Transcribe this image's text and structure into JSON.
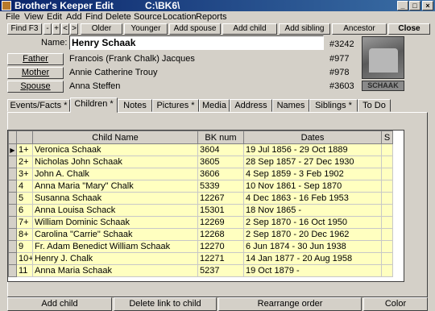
{
  "window": {
    "title": "Brother's Keeper Edit",
    "path": "C:\\BK6\\",
    "min": "_",
    "max": "□",
    "close": "×"
  },
  "menu": [
    "File",
    "View",
    "Edit",
    "Add",
    "Find",
    "Delete",
    "Source",
    "Location",
    "Reports"
  ],
  "toolbar": {
    "find": "Find  F3",
    "minus": "-",
    "plus": "+",
    "prev": "<",
    "next": ">",
    "older": "Older",
    "younger": "Younger",
    "add_spouse": "Add spouse",
    "add_child": "Add child",
    "add_sibling": "Add sibling",
    "ancestor": "Ancestor",
    "close": "Close"
  },
  "person": {
    "name_label": "Name:",
    "name": "Henry Schaak",
    "id": "#3242",
    "father_label": "Father",
    "father": "Francois (Frank Chalk) Jacques",
    "father_id": "#977",
    "mother_label": "Mother",
    "mother": "Annie Catherine Trouy",
    "mother_id": "#978",
    "spouse_label": "Spouse",
    "spouse": "Anna Steffen",
    "spouse_id": "#3603",
    "photo_caption": "SCHAAK"
  },
  "tabs": [
    "Events/Facts *",
    "Children *",
    "Notes",
    "Pictures *",
    "Media",
    "Address",
    "Names",
    "Siblings *",
    "To Do"
  ],
  "table": {
    "headers": [
      "",
      "",
      "Child Name",
      "BK num",
      "Dates",
      "S"
    ],
    "rows": [
      {
        "n": "1+",
        "name": "Veronica Schaak",
        "bk": "3604",
        "dates": "19 Jul 1856  - 29 Oct 1889"
      },
      {
        "n": "2+",
        "name": "Nicholas John Schaak",
        "bk": "3605",
        "dates": "28 Sep 1857  - 27 Dec 1930"
      },
      {
        "n": "3+",
        "name": "John A. Chalk",
        "bk": "3606",
        "dates": "4 Sep 1859  - 3 Feb 1902"
      },
      {
        "n": "4",
        "name": "Anna Maria \"Mary\" Chalk",
        "bk": "5339",
        "dates": "10 Nov 1861  -      Sep 1870"
      },
      {
        "n": "5",
        "name": "Susanna Schaak",
        "bk": "12267",
        "dates": "4 Dec 1863  - 16 Feb 1953"
      },
      {
        "n": "6",
        "name": "Anna Louisa Schack",
        "bk": "15301",
        "dates": "18 Nov 1865  -"
      },
      {
        "n": "7+",
        "name": "William Dominic Schaak",
        "bk": "12269",
        "dates": "2 Sep 1870  - 16 Oct 1950"
      },
      {
        "n": "8+",
        "name": "Carolina \"Carrie\" Schaak",
        "bk": "12268",
        "dates": "2 Sep 1870  - 20 Dec 1962"
      },
      {
        "n": "9",
        "name": "Fr. Adam Benedict William Schaak",
        "bk": "12270",
        "dates": "6 Jun 1874  - 30 Jun 1938"
      },
      {
        "n": "10+",
        "name": "Henry J. Chalk",
        "bk": "12271",
        "dates": "14 Jan 1877  - 20 Aug 1958"
      },
      {
        "n": "11",
        "name": "Anna Maria Schaak",
        "bk": "5237",
        "dates": "19 Oct 1879  -"
      }
    ]
  },
  "bottom": {
    "add_child": "Add child",
    "delete_link": "Delete link to child",
    "rearrange": "Rearrange order",
    "color": "Color"
  },
  "colors": {
    "title_bar": "#0a246a",
    "row_bg": "#ffffc0",
    "chrome": "#d4d0c8"
  }
}
